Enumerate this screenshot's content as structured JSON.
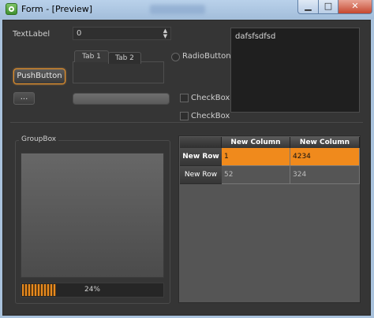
{
  "window": {
    "title": "Form - [Preview]",
    "min_label": "▁",
    "max_label": "□",
    "close_label": "✕"
  },
  "form": {
    "text_label": "TextLabel",
    "spinbox_value": "0",
    "push_button_label": "PushButton",
    "tool_button_label": "...",
    "tabs": [
      "Tab 1",
      "Tab 2"
    ],
    "radio_label": "RadioButton",
    "checkbox1_label": "CheckBox",
    "checkbox2_label": "CheckBox",
    "text_edit_value": "dafsfsdfsd",
    "groupbox_title": "GroupBox",
    "progress": {
      "value": 0.24,
      "label": "24%"
    },
    "accent_color": "#f08a1c"
  },
  "table": {
    "columns": [
      "New Column",
      "New Column"
    ],
    "rows": [
      {
        "header": "New Row",
        "cells": [
          "1",
          "4234"
        ],
        "selected": true
      },
      {
        "header": "New Row",
        "cells": [
          "52",
          "324"
        ],
        "selected": false
      }
    ]
  }
}
